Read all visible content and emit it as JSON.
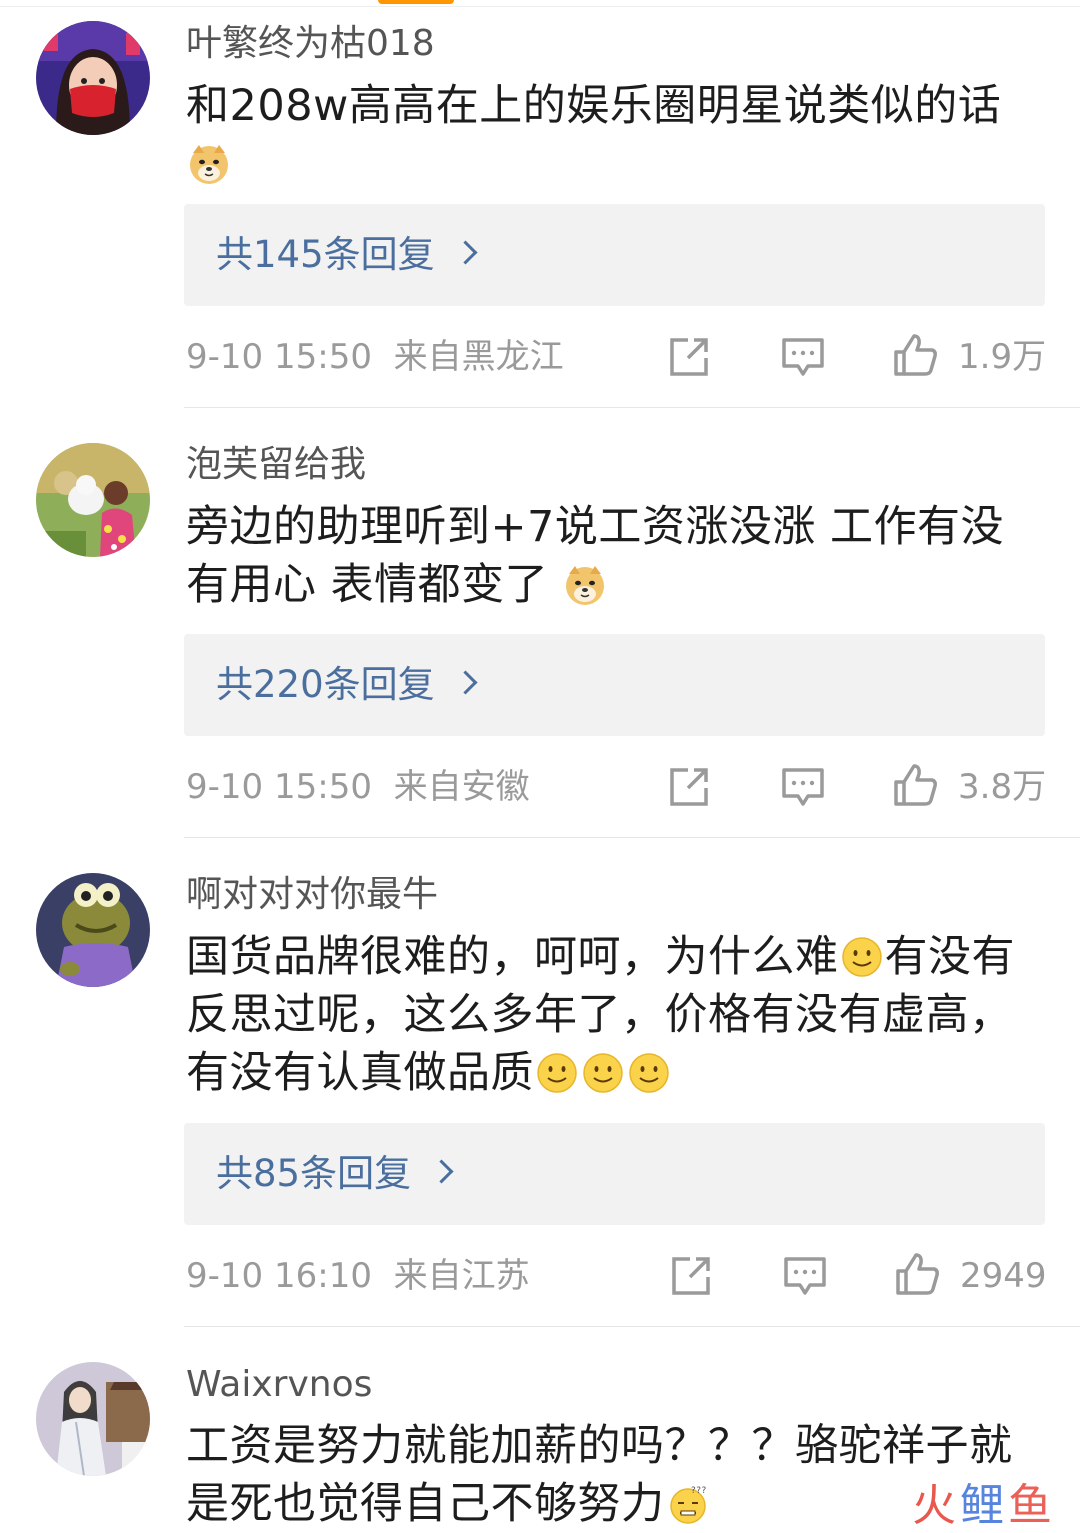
{
  "colors": {
    "link": "#4a6f9e",
    "meta": "#9a9a9a",
    "reply_bg": "#f2f2f2",
    "watermark_red": "#e8453a",
    "watermark_blue": "#3a6fd8"
  },
  "comments": [
    {
      "username": "叶繁终为枯018",
      "text_lines": [
        "和208w高高在上的娱乐圈明星说类似的话"
      ],
      "emoji_after": [
        "doge-emoji"
      ],
      "reply_label": "共145条回复",
      "time": "9-10 15:50",
      "location": "来自黑龙江",
      "likes": "1.9万"
    },
    {
      "username": "泡芙留给我",
      "text_lines": [
        "旁边的助理听到+7说工资涨没涨 工作有没",
        "有用心 表情都变了"
      ],
      "emoji_after": [
        "doge-emoji"
      ],
      "reply_label": "共220条回复",
      "time": "9-10 15:50",
      "location": "来自安徽",
      "likes": "3.8万"
    },
    {
      "username": "啊对对对你最牛",
      "text_lines": [
        "国货品牌很难的，呵呵，为什么难",
        "有没有",
        "反思过呢，这么多年了，价格有没有虚高，",
        "有没有认真做品质"
      ],
      "emoji_after": [
        "smile-emoji",
        "smile-emoji",
        "smile-emoji",
        "smile-emoji"
      ],
      "reply_label": "共85条回复",
      "time": "9-10 16:10",
      "location": "来自江苏",
      "likes": "2949"
    },
    {
      "username": "Waixrvnos",
      "text_lines": [
        "工资是努力就能加薪的吗？？？骆驼祥子就",
        "是死也觉得自己不够努力"
      ],
      "emoji_after": [
        "dizzy-emoji"
      ]
    }
  ],
  "watermark": {
    "text": "火鲤鱼"
  }
}
